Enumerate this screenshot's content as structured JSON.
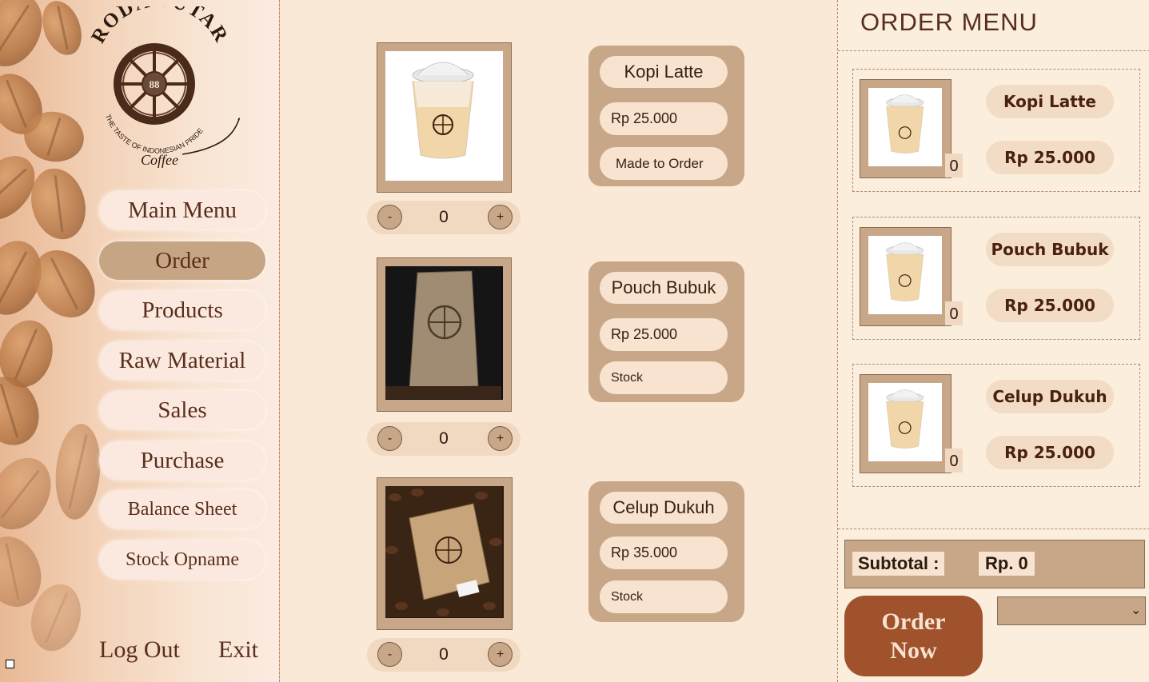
{
  "brand": {
    "name": "RODA PUTAR",
    "number": "88",
    "tagline": "THE TASTE OF INDONESIAN PRIDE",
    "script": "Coffee"
  },
  "sidebar": {
    "items": [
      {
        "label": "Main Menu"
      },
      {
        "label": "Order",
        "active": true
      },
      {
        "label": "Products"
      },
      {
        "label": "Raw Material"
      },
      {
        "label": "Sales"
      },
      {
        "label": "Purchase"
      },
      {
        "label": "Balance Sheet"
      },
      {
        "label": "Stock Opname"
      }
    ],
    "logout": "Log Out",
    "exit": "Exit"
  },
  "products": [
    {
      "name": "Kopi Latte",
      "price": "Rp 25.000",
      "status": "Made to Order",
      "qty": "0",
      "image": "iced-coffee-cup"
    },
    {
      "name": "Pouch Bubuk",
      "price": "Rp 25.000",
      "status": "Stock",
      "qty": "0",
      "image": "coffee-pouch"
    },
    {
      "name": "Celup Dukuh",
      "price": "Rp 35.000",
      "status": "Stock",
      "qty": "0",
      "image": "coffee-box-on-beans"
    }
  ],
  "stepper": {
    "minus": "-",
    "plus": "+"
  },
  "order_menu": {
    "title": "ORDER MENU",
    "items": [
      {
        "name": "Kopi Latte",
        "price": "Rp 25.000",
        "qty": "0"
      },
      {
        "name": "Pouch Bubuk",
        "price": "Rp 25.000",
        "qty": "0"
      },
      {
        "name": "Celup Dukuh",
        "price": "Rp 25.000",
        "qty": "0"
      }
    ],
    "subtotal_label": "Subtotal :",
    "subtotal_value": "Rp. 0",
    "order_now": "Order Now",
    "dropdown_value": ""
  },
  "colors": {
    "background": "#f9e9d6",
    "frame": "#c8a789",
    "accent_button": "#a0522d",
    "text_dark": "#5a2e1c"
  }
}
